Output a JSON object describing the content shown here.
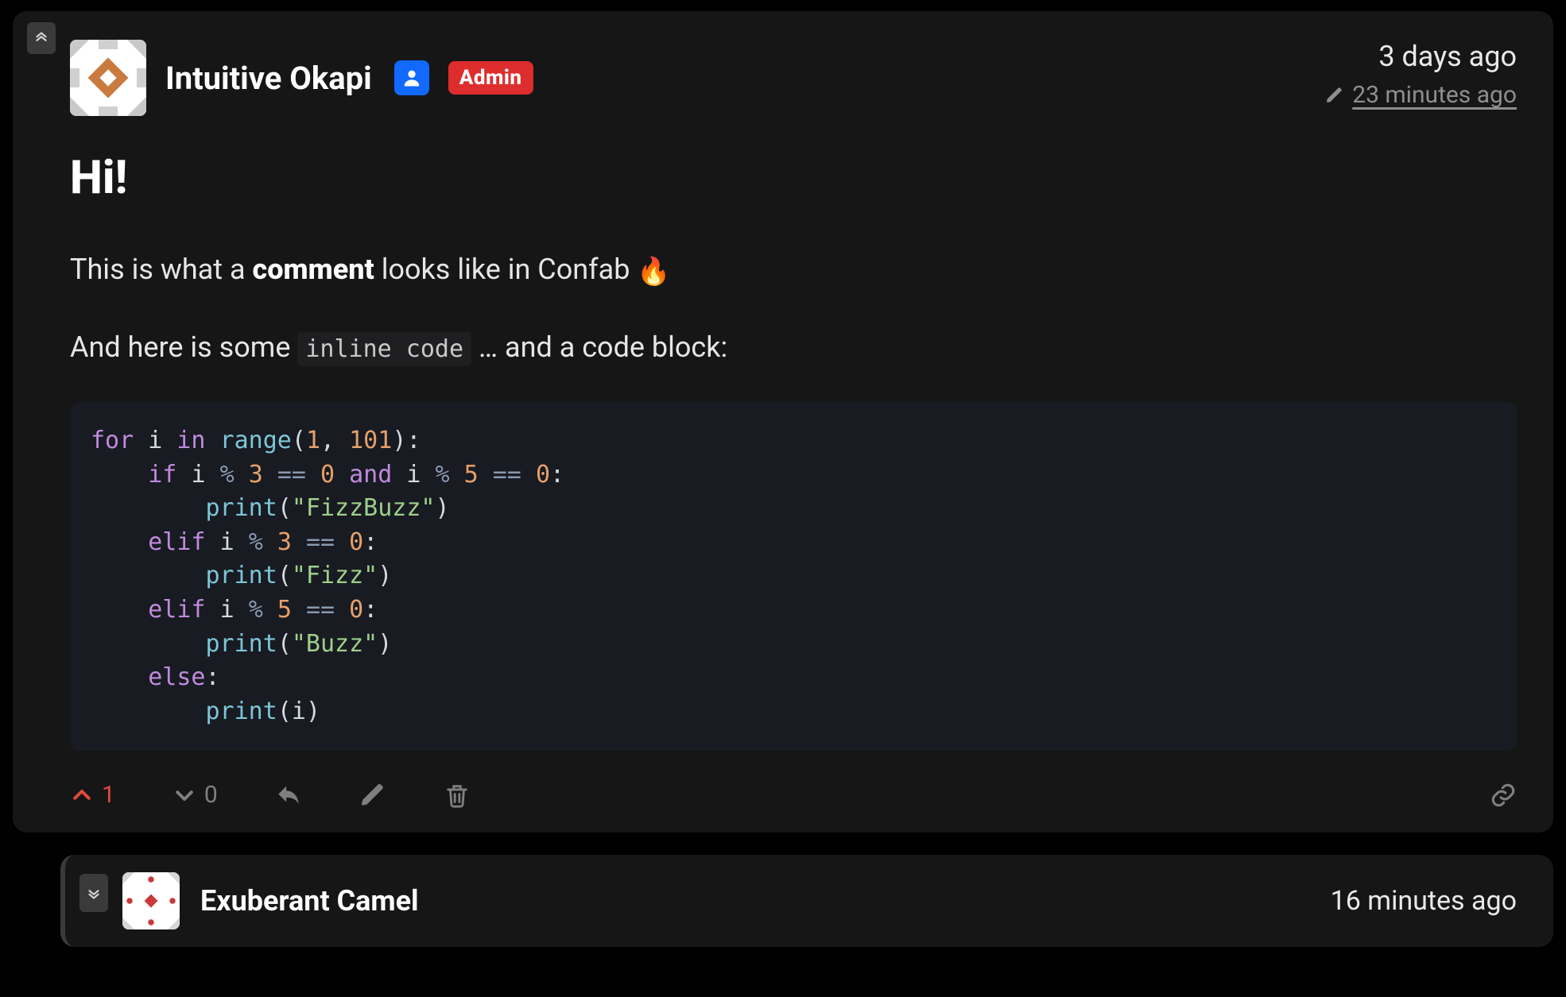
{
  "comment": {
    "author": "Intuitive Okapi",
    "admin_label": "Admin",
    "posted": "3 days ago",
    "edited": "23 minutes ago",
    "heading": "Hi!",
    "p1_pre": "This is what a ",
    "p1_bold": "comment",
    "p1_post": " looks like in Confab ",
    "p1_emoji": "🔥",
    "p2_pre": "And here is some ",
    "p2_code": "inline code",
    "p2_post": " … and a code block:",
    "upvotes": "1",
    "downvotes": "0",
    "code": {
      "l1_for": "for",
      "l1_in": "in",
      "l1_range": "range",
      "l1_n1": "1",
      "l1_n2": "101",
      "l2_if": "if",
      "l2_and": "and",
      "l2_n3": "3",
      "l2_n5": "5",
      "l2_eq": "==",
      "l2_zero": "0",
      "l3_print": "print",
      "l3_str": "\"FizzBuzz\"",
      "l4_elif": "elif",
      "l5_str": "\"Fizz\"",
      "l7_str": "\"Buzz\"",
      "l8_else": "else",
      "id_i": "i"
    }
  },
  "reply": {
    "author": "Exuberant Camel",
    "posted": "16 minutes ago"
  }
}
